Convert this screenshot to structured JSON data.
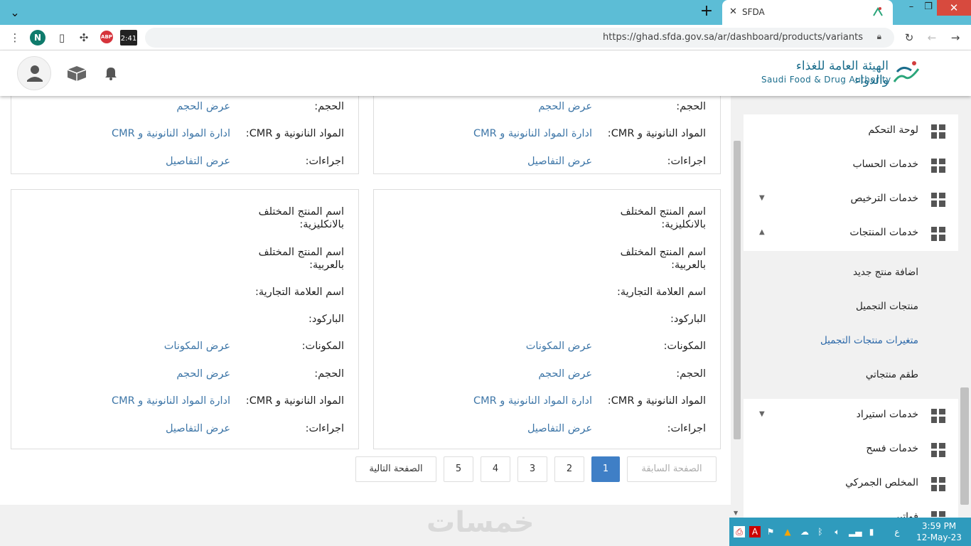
{
  "browser": {
    "tab_title": "SFDA",
    "url": "https://ghad.sfda.gov.sa/ar/dashboard/products/variants",
    "profile_initial": "N",
    "abp_label": "ABP",
    "ext_time": "2:41"
  },
  "header": {
    "logo_ar": "الهيئة العامة للغذاء والدواء",
    "logo_en": "Saudi Food & Drug Authority"
  },
  "labels": {
    "name_en": "اسم المنتج المختلف بالانكليزية:",
    "name_ar": "اسم المنتج المختلف بالعربية:",
    "brand": "اسم العلامة التجارية:",
    "barcode": "الباركود:",
    "ingredients": "المكونات:",
    "volume": "الحجم:",
    "nano": "المواد النانونية و CMR:",
    "actions": "اجراءات:"
  },
  "links": {
    "show_ingredients": "عرض المكونات",
    "show_volume": "عرض الحجم",
    "manage_nano": "ادارة المواد النانونية و CMR",
    "show_details": "عرض التفاصيل"
  },
  "pagination": {
    "prev": "الصفحة السابقة",
    "next": "الصفحة التالية",
    "pages": [
      "1",
      "2",
      "3",
      "4",
      "5"
    ],
    "current": "1"
  },
  "sidebar": {
    "items": [
      {
        "label": "لوحة التحكم"
      },
      {
        "label": "خدمات الحساب"
      },
      {
        "label": "خدمات الترخيص"
      },
      {
        "label": "خدمات المنتجات"
      },
      {
        "label": "خدمات استيراد"
      },
      {
        "label": "خدمات فسح"
      },
      {
        "label": "المخلص الجمركي"
      },
      {
        "label": "فواتير"
      }
    ],
    "sub_items": [
      {
        "label": "اضافة منتج جديد"
      },
      {
        "label": "منتجات التجميل"
      },
      {
        "label": "متغيرات منتجات التجميل"
      },
      {
        "label": "طقم منتجاتي"
      }
    ]
  },
  "taskbar": {
    "time": "3:59 PM",
    "date": "12-May-23",
    "lang": "ع"
  },
  "watermark": "خمسات",
  "colors": {
    "tabbar": "#5cbdd6",
    "link": "#3f77a8",
    "accent": "#3f7fc6",
    "taskbar": "#2f9bbd"
  }
}
